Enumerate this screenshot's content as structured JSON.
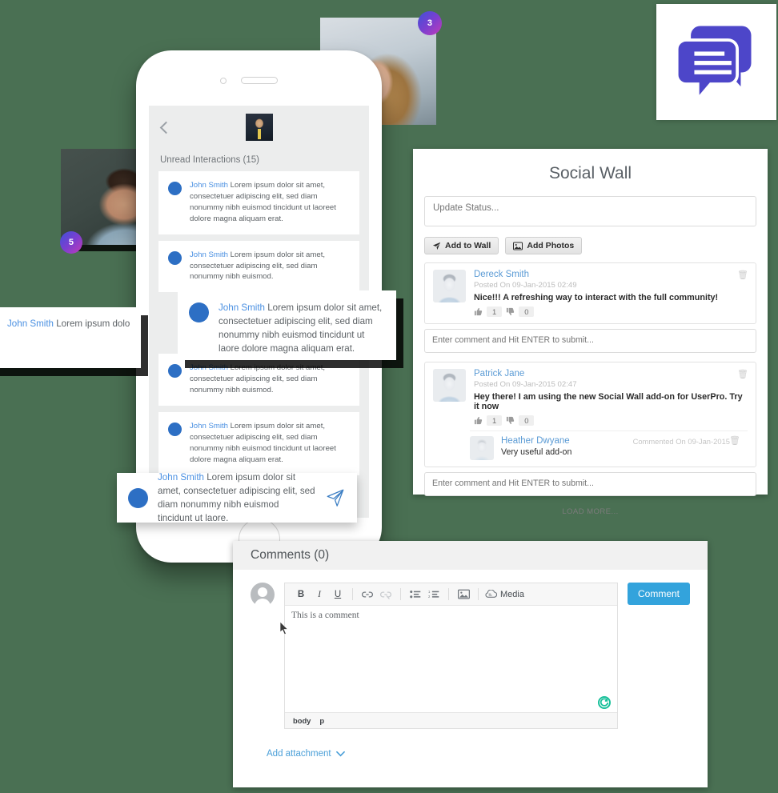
{
  "background_color": "#4a7053",
  "logo_tile": {
    "name": "speech-bubbles-logo",
    "color": "#4d46c9"
  },
  "photos": [
    {
      "name": "photo-woman",
      "badge": "3"
    },
    {
      "name": "photo-man",
      "badge": "5"
    }
  ],
  "phone": {
    "screen": {
      "back_label": "",
      "unread_label": "Unread Interactions (15)",
      "messages": [
        {
          "author": "John Smith",
          "text": " Lorem ipsum dolor sit amet, consectetuer adipiscing elit, sed diam nonummy nibh euismod tincidunt ut laoreet dolore magna aliquam erat."
        },
        {
          "author": "John Smith",
          "text": " Lorem ipsum dolor sit amet, consectetuer adipiscing elit, sed diam nonummy nibh euismod."
        },
        {
          "author": "John Smith",
          "text": " Lorem ipsum dolor sit amet, consectetuer adipiscing elit, sed diam nonummy nibh euismod."
        },
        {
          "author": "John Smith",
          "text": " Lorem ipsum dolor sit amet, consectetuer adipiscing elit, sed diam nonummy nibh euismod tincidunt ut laoreet dolore magna aliquam erat."
        }
      ]
    }
  },
  "floating_cards": [
    {
      "author": "John Smith",
      "text": " Lorem ipsum dolor sit amet, consectetuer adipiscing elit, sed diam nonummy nibh euismod tincidunt ut laore dolore magna aliquam erat."
    },
    {
      "author": "John Smith",
      "text": " Lorem ipsum dolor sit amet, consectetuer adipiscing elit, sed diam nibh euismod tincidunt ut laoreet dolore magna aliquam erat volutpat. Ut"
    },
    {
      "author": "John Smith",
      "text": " Lorem ipsum dolor sit amet, consectetuer adipiscing elit, sed diam nonummy nibh euismod tincidunt ut laore."
    }
  ],
  "social_wall": {
    "title": "Social Wall",
    "status_placeholder": "Update Status...",
    "add_to_wall_label": "Add to Wall",
    "add_photos_label": "Add Photos",
    "comment_placeholder": "Enter comment and Hit ENTER to submit...",
    "load_more_label": "LOAD MORE...",
    "posts": [
      {
        "author": "Dereck Smith",
        "meta": "Posted On 09-Jan-2015 02:49",
        "body": "Nice!!! A refreshing way to interact with the full community!",
        "likes": "1",
        "dislikes": "0"
      },
      {
        "author": "Patrick Jane",
        "meta": "Posted On 09-Jan-2015 02:47",
        "body": "Hey there! I am using the new Social Wall add-on for UserPro. Try it now",
        "likes": "1",
        "dislikes": "0",
        "comment": {
          "author": "Heather Dwyane",
          "date": "Commented On 09-Jan-2015",
          "body": "Very useful add-on"
        }
      }
    ]
  },
  "comments_panel": {
    "header": "Comments (0)",
    "editor_text": "This is a comment",
    "toolbar": {
      "bold": "B",
      "italic": "I",
      "underline": "U",
      "media_label": "Media"
    },
    "path": {
      "body": "body",
      "tag": "p"
    },
    "add_attachment_label": "Add attachment",
    "comment_button_label": "Comment",
    "accent_color": "#33a3dc",
    "spellcheck_color": "#18c09a"
  }
}
